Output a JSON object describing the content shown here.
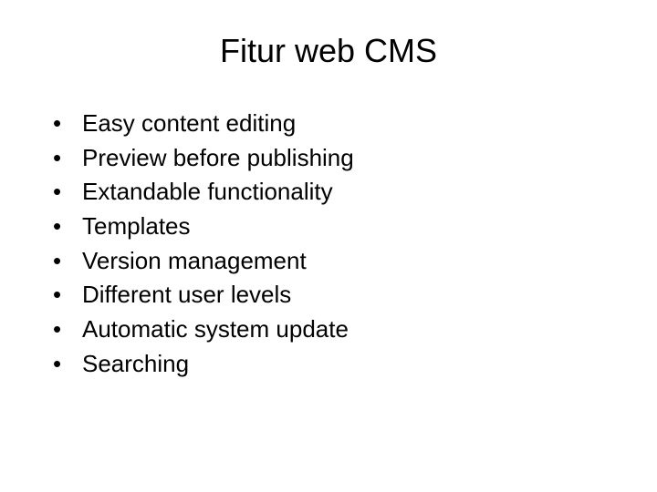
{
  "title": "Fitur web CMS",
  "bullets": [
    "Easy content editing",
    "Preview before publishing",
    "Extandable functionality",
    "Templates",
    "Version management",
    "Different user levels",
    "Automatic system update",
    "Searching"
  ]
}
